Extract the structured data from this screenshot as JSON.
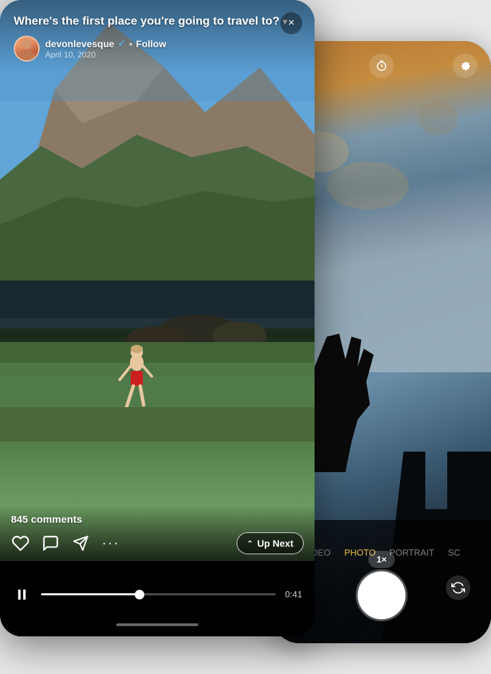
{
  "camera": {
    "modes": [
      "VIDEO",
      "PHOTO",
      "PORTRAIT",
      "SC"
    ],
    "active_mode": "PHOTO",
    "zoom": "1×",
    "top_icons": [
      "flip-camera-icon",
      "timer-icon",
      "settings-icon"
    ]
  },
  "instagram": {
    "post": {
      "title": "Where's the first place you're going to travel to?",
      "title_has_dropdown": true,
      "close_label": "×"
    },
    "author": {
      "username": "devonlevesque",
      "verified": true,
      "follow_label": "Follow",
      "date": "April 10, 2020",
      "separator": "•"
    },
    "stats": {
      "comments": "845 comments"
    },
    "actions": {
      "like_icon": "♡",
      "comment_icon": "💬",
      "share_icon": "▷",
      "more_icon": "···"
    },
    "up_next": {
      "label": "Up Next",
      "chevron": "⌃"
    },
    "playback": {
      "is_playing": false,
      "pause_icon": "⏸",
      "play_icon": "▶",
      "current_time": "0:41",
      "progress_pct": 42
    }
  }
}
